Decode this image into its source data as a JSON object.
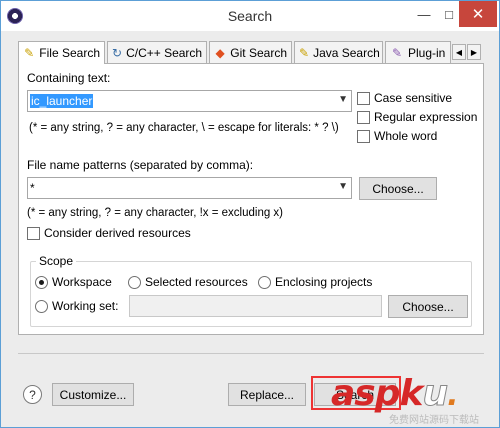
{
  "window": {
    "title": "Search",
    "close_symbol": "✕",
    "max_symbol": "□",
    "min_symbol": "—"
  },
  "tabs": [
    {
      "label": "File Search",
      "active": true,
      "icon": "file-search-icon",
      "glyph": "✎"
    },
    {
      "label": "C/C++ Search",
      "active": false,
      "icon": "cpp-search-icon",
      "glyph": "↻"
    },
    {
      "label": "Git Search",
      "active": false,
      "icon": "git-search-icon",
      "glyph": "◆"
    },
    {
      "label": "Java Search",
      "active": false,
      "icon": "java-search-icon",
      "glyph": "✎"
    },
    {
      "label": "Plug-in",
      "active": false,
      "icon": "plugin-search-icon",
      "glyph": "✎"
    }
  ],
  "tab_scroll": {
    "left": "◀",
    "right": "▶"
  },
  "containing": {
    "label": "Containing text:",
    "value": "ic_launcher",
    "hint": "(* = any string, ? = any character, \\ = escape for literals: * ? \\)",
    "options": [
      {
        "label": "Case sensitive",
        "checked": false
      },
      {
        "label": "Regular expression",
        "checked": false
      },
      {
        "label": "Whole word",
        "checked": false
      }
    ]
  },
  "file_patterns": {
    "label": "File name patterns (separated by comma):",
    "value": "*",
    "choose_label": "Choose...",
    "hint": "(* = any string, ? = any character, !x = excluding x)",
    "derived_label": "Consider derived resources",
    "derived_checked": false
  },
  "scope": {
    "title": "Scope",
    "options": [
      {
        "label": "Workspace",
        "selected": true
      },
      {
        "label": "Selected resources",
        "selected": false
      },
      {
        "label": "Enclosing projects",
        "selected": false
      },
      {
        "label": "Working set:",
        "selected": false
      }
    ],
    "working_set_value": "",
    "choose_label": "Choose..."
  },
  "footer": {
    "help_symbol": "?",
    "customize_label": "Customize...",
    "replace_label": "Replace...",
    "search_label": "Search"
  },
  "watermark": {
    "logo_main": "asp",
    "logo_k": "k",
    "logo_u": "u",
    "logo_dot": ".",
    "subtitle": "免费网站源码下载站"
  },
  "colors": {
    "accent": "#3399ff",
    "close_button": "#c7463c",
    "watermark": "#d62828"
  }
}
